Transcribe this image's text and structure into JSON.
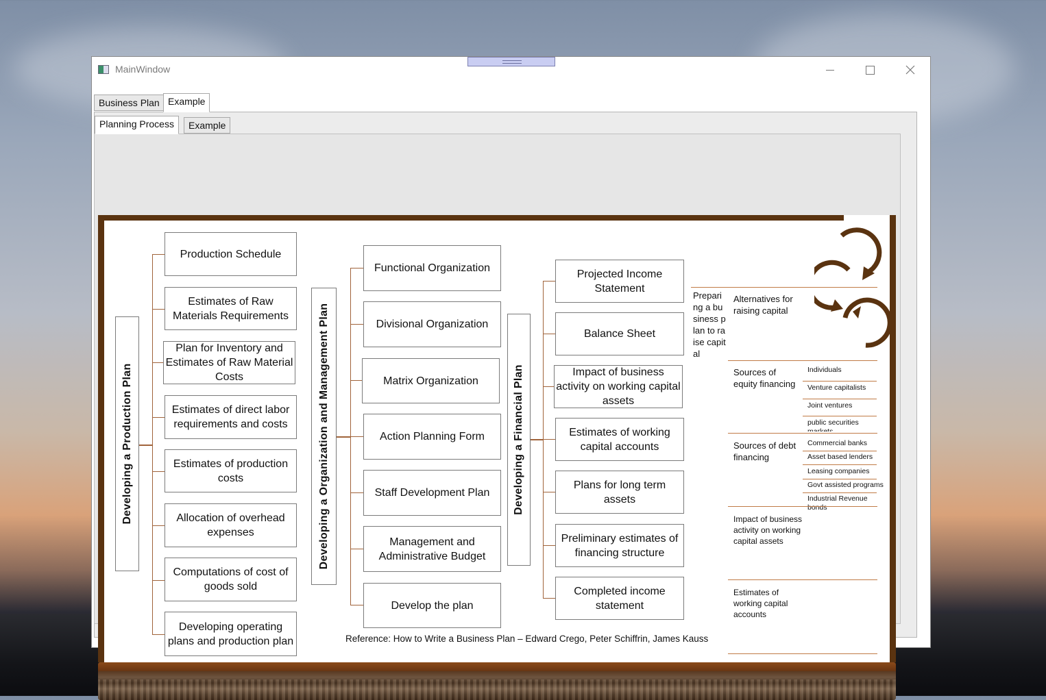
{
  "window": {
    "title": "MainWindow"
  },
  "tabs_outer": [
    {
      "label": "Business Plan"
    },
    {
      "label": "Example"
    }
  ],
  "tabs_inner": [
    {
      "label": "Planning Process"
    },
    {
      "label": "Example"
    }
  ],
  "diagram": {
    "production": {
      "title": "Developing a Production Plan",
      "items": [
        "Production Schedule",
        "Estimates of Raw Materials Requirements",
        "Plan for Inventory and Estimates of Raw Material Costs",
        "Estimates of direct labor requirements and costs",
        "Estimates of production costs",
        "Allocation of overhead expenses",
        "Computations of cost of goods sold",
        "Developing operating plans and production plan"
      ]
    },
    "organization": {
      "title": "Developing a Organization and Management Plan",
      "items": [
        "Functional Organization",
        "Divisional Organization",
        "Matrix Organization",
        "Action Planning Form",
        "Staff Development Plan",
        "Management and Administrative Budget",
        "Develop the plan"
      ]
    },
    "financial": {
      "title": "Developing a Financial Plan",
      "items": [
        "Projected Income Statement",
        "Balance Sheet",
        "Impact of business activity on working capital assets",
        "Estimates of working capital accounts",
        "Plans for long term assets",
        "Preliminary estimates of financing structure",
        "Completed income statement"
      ]
    },
    "capital": {
      "heading": "Preparing a business plan to raise capital",
      "alternatives": "Alternatives for raising capital",
      "equity": "Sources of equity financing",
      "equity_items": [
        "Individuals",
        "Venture capitalists",
        "Joint ventures",
        "public securities markets"
      ],
      "debt": "Sources of debt financing",
      "debt_items": [
        "Commercial banks",
        "Asset based lenders",
        "Leasing companies",
        "Govt assisted programs",
        "Industrial Revenue bonds"
      ],
      "impact": "Impact of business activity on working capital assets",
      "estimates": "Estimates of working capital accounts"
    },
    "reference": "Reference: How to Write a Business Plan – Edward Crego, Peter Schiffrin, James Kauss"
  },
  "colors": {
    "frame": "#5a3310",
    "connector": "#a0633a",
    "rule": "#c07a45"
  }
}
